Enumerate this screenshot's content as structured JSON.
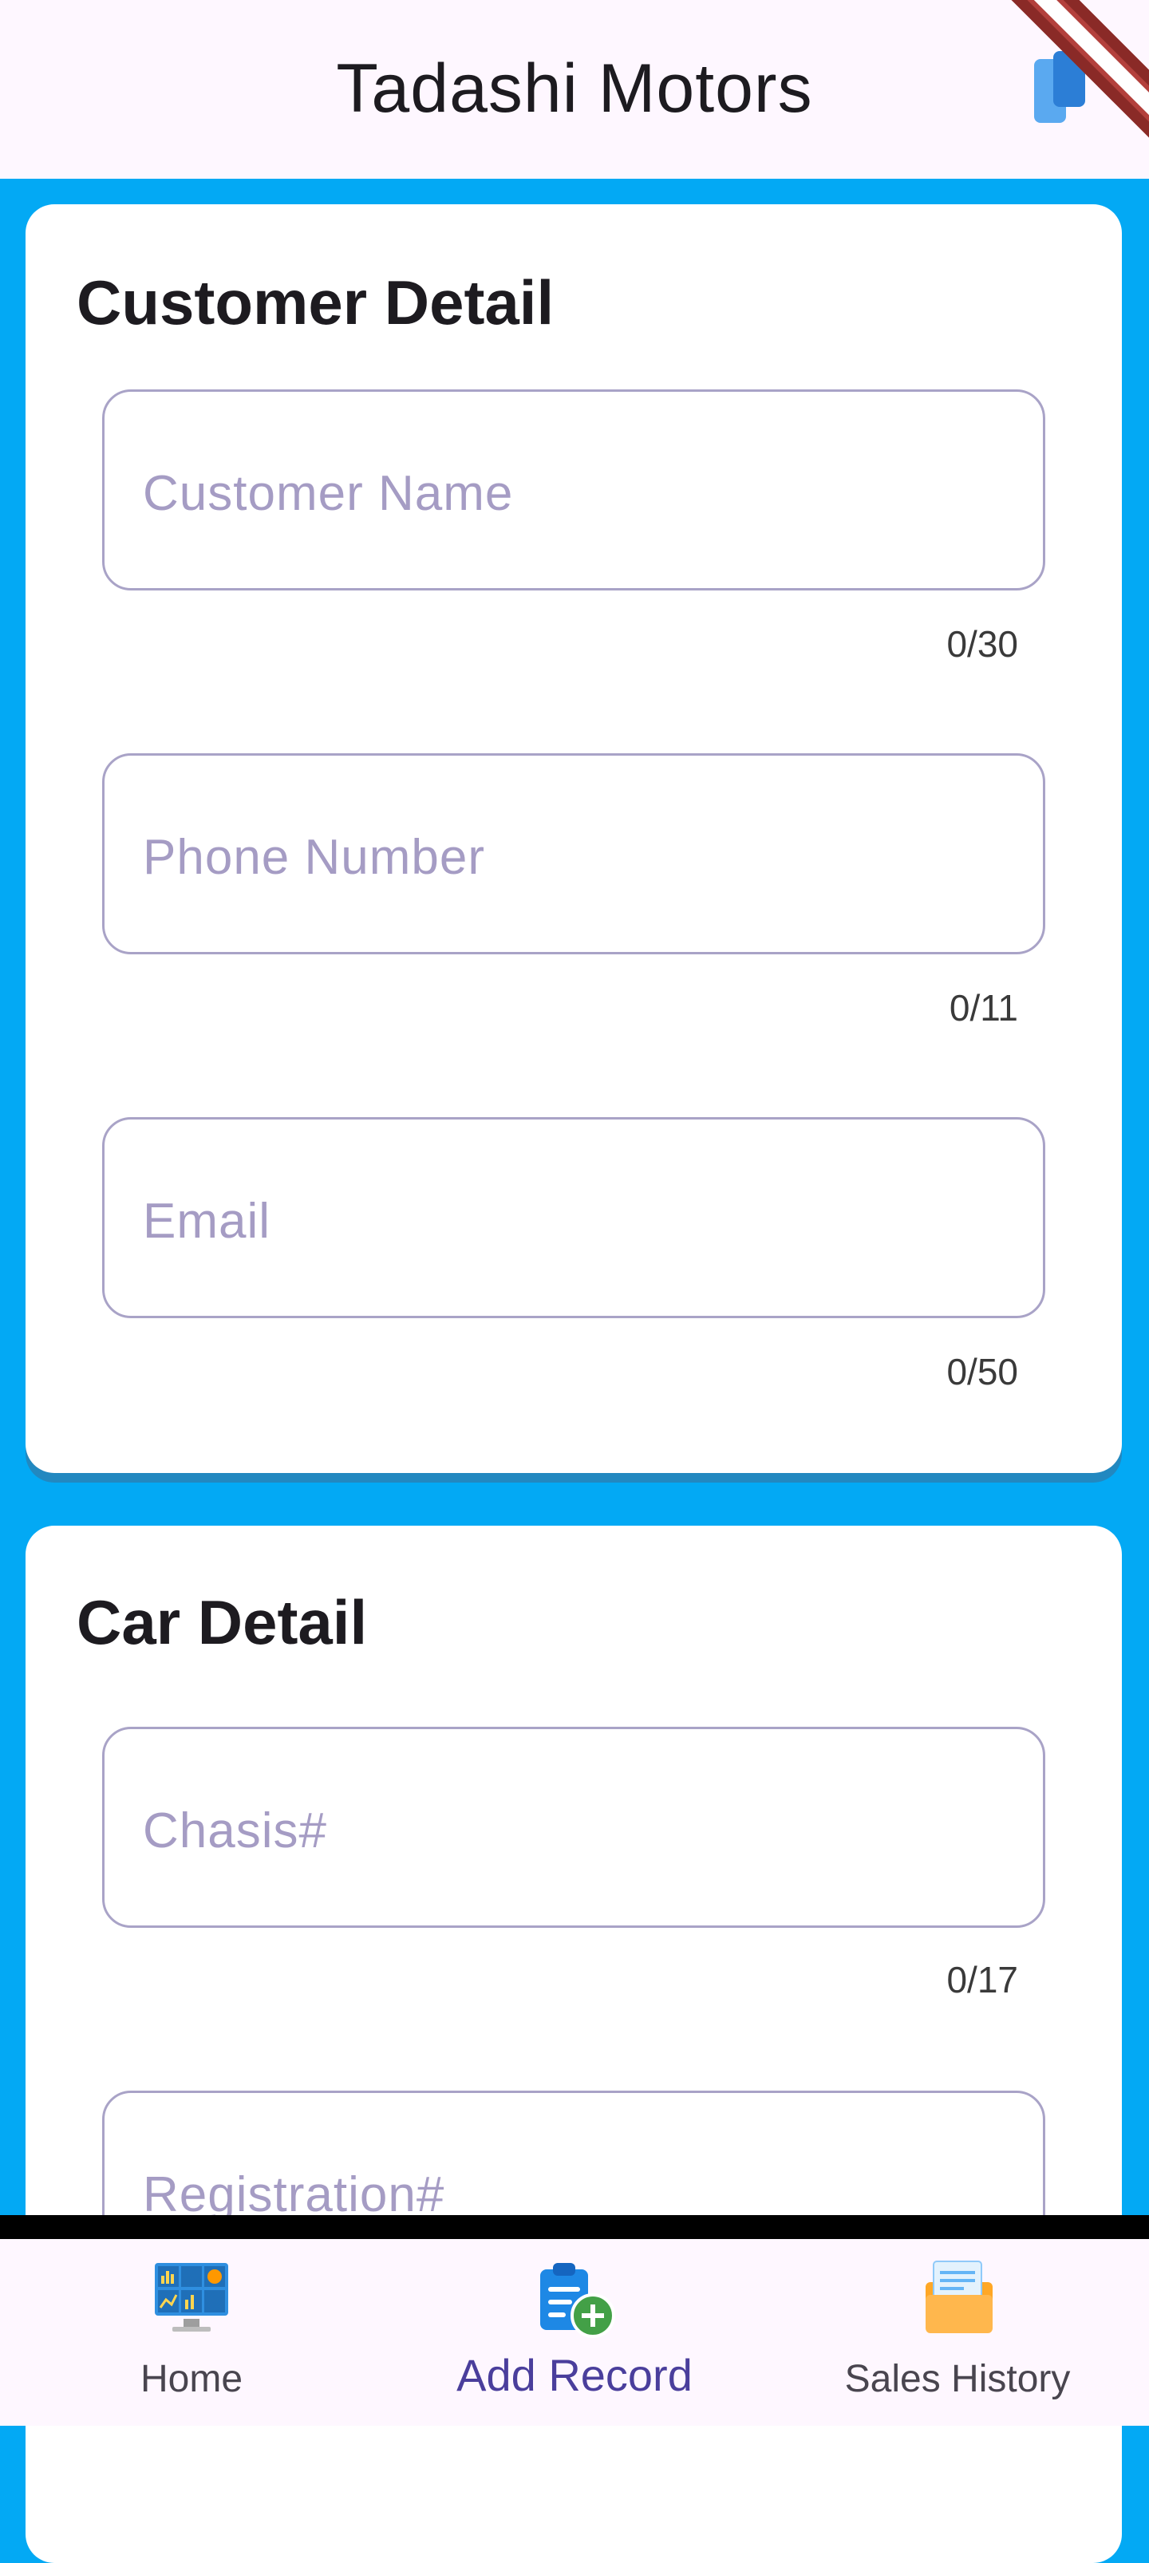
{
  "appbar": {
    "title": "Tadashi Motors",
    "action_icon": "debug-banner-icon"
  },
  "customer_card": {
    "title": "Customer Detail",
    "fields": [
      {
        "placeholder": "Customer Name",
        "counter": "0/30"
      },
      {
        "placeholder": "Phone Number",
        "counter": "0/11"
      },
      {
        "placeholder": "Email",
        "counter": "0/50"
      }
    ]
  },
  "car_card": {
    "title": "Car Detail",
    "fields": [
      {
        "placeholder": "Chasis#",
        "counter": "0/17"
      },
      {
        "placeholder": "Registration#"
      }
    ]
  },
  "bottom_nav": {
    "items": [
      {
        "label": "Home",
        "icon": "dashboard-icon"
      },
      {
        "label": "Add Record",
        "icon": "clipboard-add-icon",
        "active": true
      },
      {
        "label": "Sales History",
        "icon": "folder-icon"
      }
    ]
  },
  "colors": {
    "background": "#03a9f4",
    "accent": "#4a3e9c",
    "field_border": "#a9a3c7"
  }
}
